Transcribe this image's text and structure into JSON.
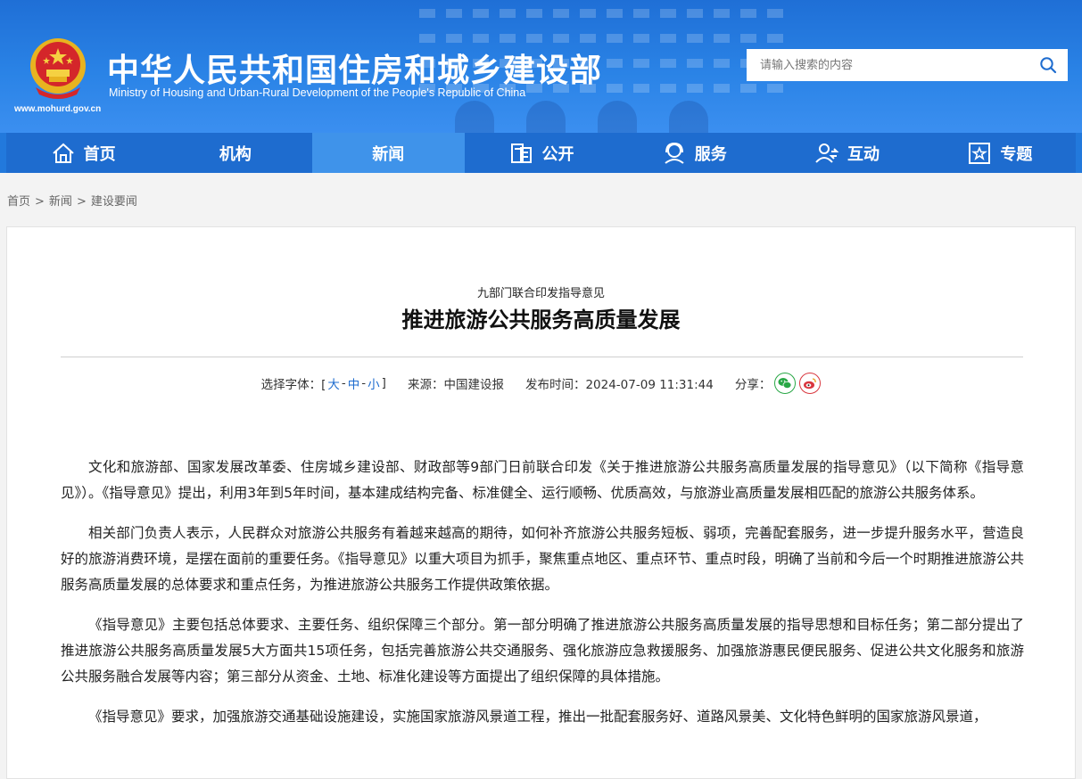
{
  "header": {
    "title_cn": "中华人民共和国住房和城乡建设部",
    "title_en": "Ministry of Housing and Urban-Rural Development of the People's Republic of China",
    "site_url": "www.mohurd.gov.cn",
    "search_placeholder": "请输入搜索的内容"
  },
  "nav": {
    "items": [
      {
        "label": "首页",
        "icon": "home-icon"
      },
      {
        "label": "机构",
        "icon": ""
      },
      {
        "label": "新闻",
        "icon": "",
        "active": true
      },
      {
        "label": "公开",
        "icon": "document-icon"
      },
      {
        "label": "服务",
        "icon": "service-icon"
      },
      {
        "label": "互动",
        "icon": "interaction-icon"
      },
      {
        "label": "专题",
        "icon": "star-box-icon"
      }
    ]
  },
  "breadcrumb": {
    "home": "首页",
    "news": "新闻",
    "current": "建设要闻",
    "sep": ">"
  },
  "article": {
    "kicker": "九部门联合印发指导意见",
    "headline": "推进旅游公共服务高质量发展",
    "font_label": "选择字体：[",
    "font_large": "大",
    "font_medium": "中",
    "font_small": "小",
    "font_dash": "-",
    "font_end": "]",
    "source": "来源：中国建设报",
    "published": "发布时间：2024-07-09 11:31:44",
    "share_label": "分享：",
    "paragraphs": [
      "文化和旅游部、国家发展改革委、住房城乡建设部、财政部等9部门日前联合印发《关于推进旅游公共服务高质量发展的指导意见》（以下简称《指导意见》）。《指导意见》提出，利用3年到5年时间，基本建成结构完备、标准健全、运行顺畅、优质高效，与旅游业高质量发展相匹配的旅游公共服务体系。",
      "相关部门负责人表示，人民群众对旅游公共服务有着越来越高的期待，如何补齐旅游公共服务短板、弱项，完善配套服务，进一步提升服务水平，营造良好的旅游消费环境，是摆在面前的重要任务。《指导意见》以重大项目为抓手，聚焦重点地区、重点环节、重点时段，明确了当前和今后一个时期推进旅游公共服务高质量发展的总体要求和重点任务，为推进旅游公共服务工作提供政策依据。",
      "《指导意见》主要包括总体要求、主要任务、组织保障三个部分。第一部分明确了推进旅游公共服务高质量发展的指导思想和目标任务；第二部分提出了推进旅游公共服务高质量发展5大方面共15项任务，包括完善旅游公共交通服务、强化旅游应急救援服务、加强旅游惠民便民服务、促进公共文化服务和旅游公共服务融合发展等内容；第三部分从资金、土地、标准化建设等方面提出了组织保障的具体措施。",
      "《指导意见》要求，加强旅游交通基础设施建设，实施国家旅游风景道工程，推出一批配套服务好、道路风景美、文化特色鲜明的国家旅游风景道，"
    ]
  },
  "colors": {
    "header_blue": "#2a83e6",
    "nav_blue": "#1e6ccf",
    "nav_active": "#3f93ea",
    "link_blue": "#1e6ccf",
    "wechat_green": "#28a745",
    "weibo_red": "#d9363e"
  }
}
